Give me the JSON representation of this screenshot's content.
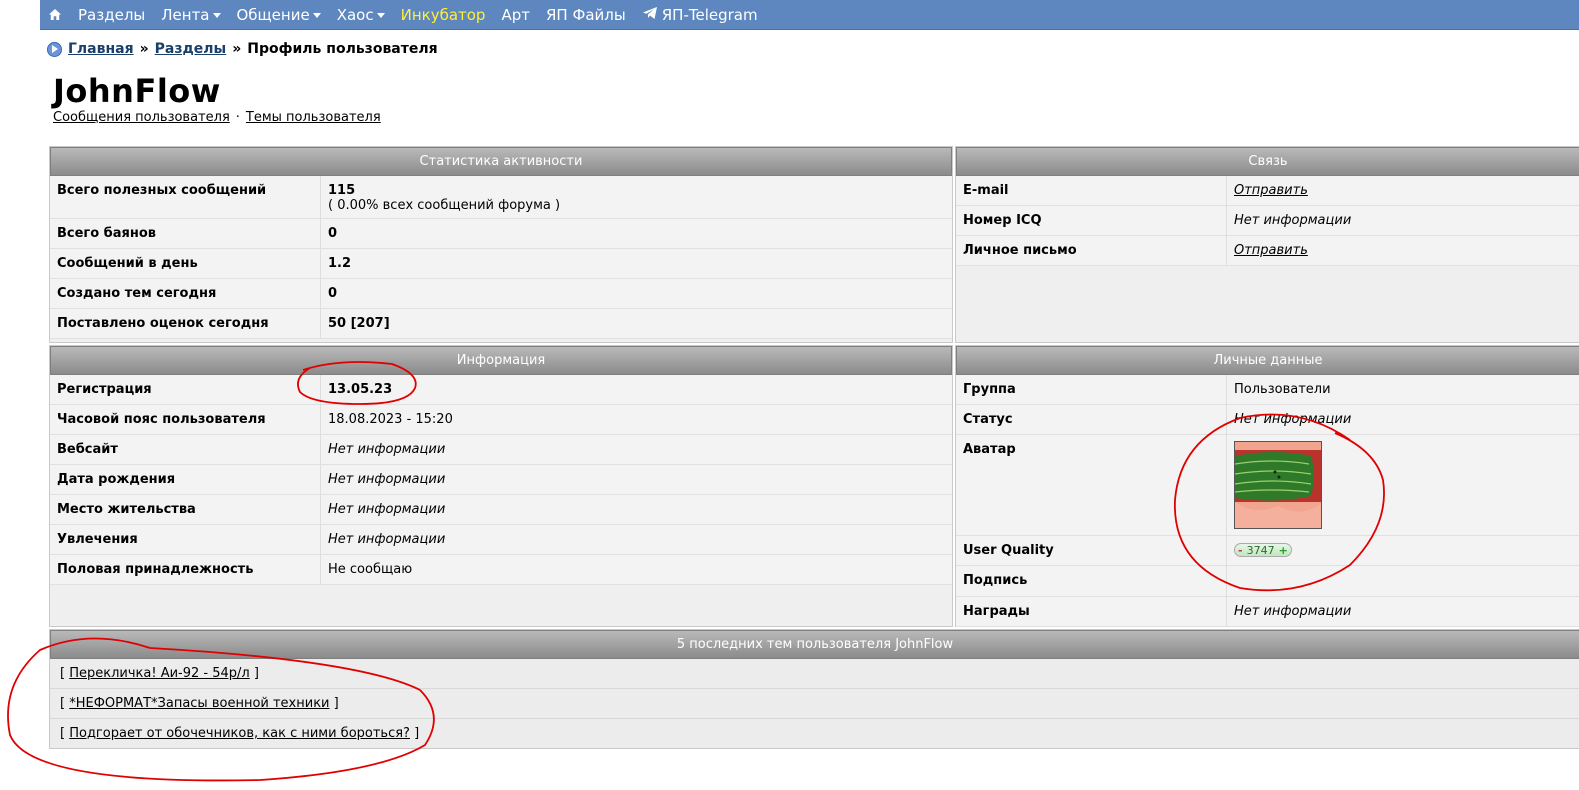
{
  "nav": {
    "items": [
      {
        "label": "Разделы",
        "dropdown": false,
        "yellow": false
      },
      {
        "label": "Лента",
        "dropdown": true,
        "yellow": false
      },
      {
        "label": "Общение",
        "dropdown": true,
        "yellow": false
      },
      {
        "label": "Хаос",
        "dropdown": true,
        "yellow": false
      },
      {
        "label": "Инкубатор",
        "dropdown": false,
        "yellow": true
      },
      {
        "label": "Арт",
        "dropdown": false,
        "yellow": false
      },
      {
        "label": "ЯП Файлы",
        "dropdown": false,
        "yellow": false
      },
      {
        "label": "ЯП-Telegram",
        "dropdown": false,
        "yellow": false
      }
    ]
  },
  "breadcrumb": {
    "home": "Главная",
    "sections": "Разделы",
    "current": "Профиль пользователя",
    "sep": "»"
  },
  "profile": {
    "username": "JohnFlow",
    "link_posts": "Сообщения пользователя",
    "link_topics": "Темы пользователя",
    "link_sep": "·"
  },
  "stats": {
    "title": "Статистика активности",
    "rows": [
      {
        "label": "Всего полезных сообщений",
        "value": "115",
        "sub": "( 0.00% всех сообщений форума )"
      },
      {
        "label": "Всего баянов",
        "value": "0"
      },
      {
        "label": "Сообщений в день",
        "value": "1.2"
      },
      {
        "label": "Создано тем сегодня",
        "value": "0"
      },
      {
        "label": "Поставлено оценок сегодня",
        "value": "50 [207]"
      }
    ]
  },
  "contact": {
    "title": "Связь",
    "rows": [
      {
        "label": "E-mail",
        "value": "Отправить",
        "link": true
      },
      {
        "label": "Номер ICQ",
        "value": "Нет информации",
        "link": false
      },
      {
        "label": "Личное письмо",
        "value": "Отправить",
        "link": true
      }
    ]
  },
  "info": {
    "title": "Информация",
    "rows": [
      {
        "label": "Регистрация",
        "value": "13.05.23",
        "style": "b"
      },
      {
        "label": "Часовой пояс пользователя",
        "value": "18.08.2023 - 15:20",
        "style": ""
      },
      {
        "label": "Вебсайт",
        "value": "Нет информации",
        "style": "it"
      },
      {
        "label": "Дата рождения",
        "value": "Нет информации",
        "style": "it"
      },
      {
        "label": "Место жительства",
        "value": "Нет информации",
        "style": "it"
      },
      {
        "label": "Увлечения",
        "value": "Нет информации",
        "style": "it"
      },
      {
        "label": "Половая принадлежность",
        "value": "Не сообщаю",
        "style": ""
      }
    ]
  },
  "personal": {
    "title": "Личные данные",
    "group_label": "Группа",
    "group_value": "Пользователи",
    "status_label": "Статус",
    "status_value": "Нет информации",
    "avatar_label": "Аватар",
    "quality_label": "User Quality",
    "quality_value": "3747",
    "quality_minus": "-",
    "quality_plus": "+",
    "signature_label": "Подпись",
    "awards_label": "Награды",
    "awards_value": "Нет информации"
  },
  "topics": {
    "title": "5 последних тем пользователя JohnFlow",
    "items": [
      "Перекличка! Аи-92 - 54р/л",
      "*НЕФОРМАТ*Запасы военной техники",
      "Подгорает от обочечников, как с ними бороться?"
    ],
    "open": "[",
    "close": "]"
  },
  "colors": {
    "nav_bg": "#5f87bf",
    "nav_highlight": "#ffef3a",
    "header_gradient_top": "#b9b9b9",
    "header_gradient_bottom": "#8b8b8b",
    "annotation_red": "#e00000"
  },
  "icons": {
    "home": "home-icon",
    "telegram": "telegram-icon",
    "breadcrumb": "breadcrumb-arrow-icon"
  }
}
